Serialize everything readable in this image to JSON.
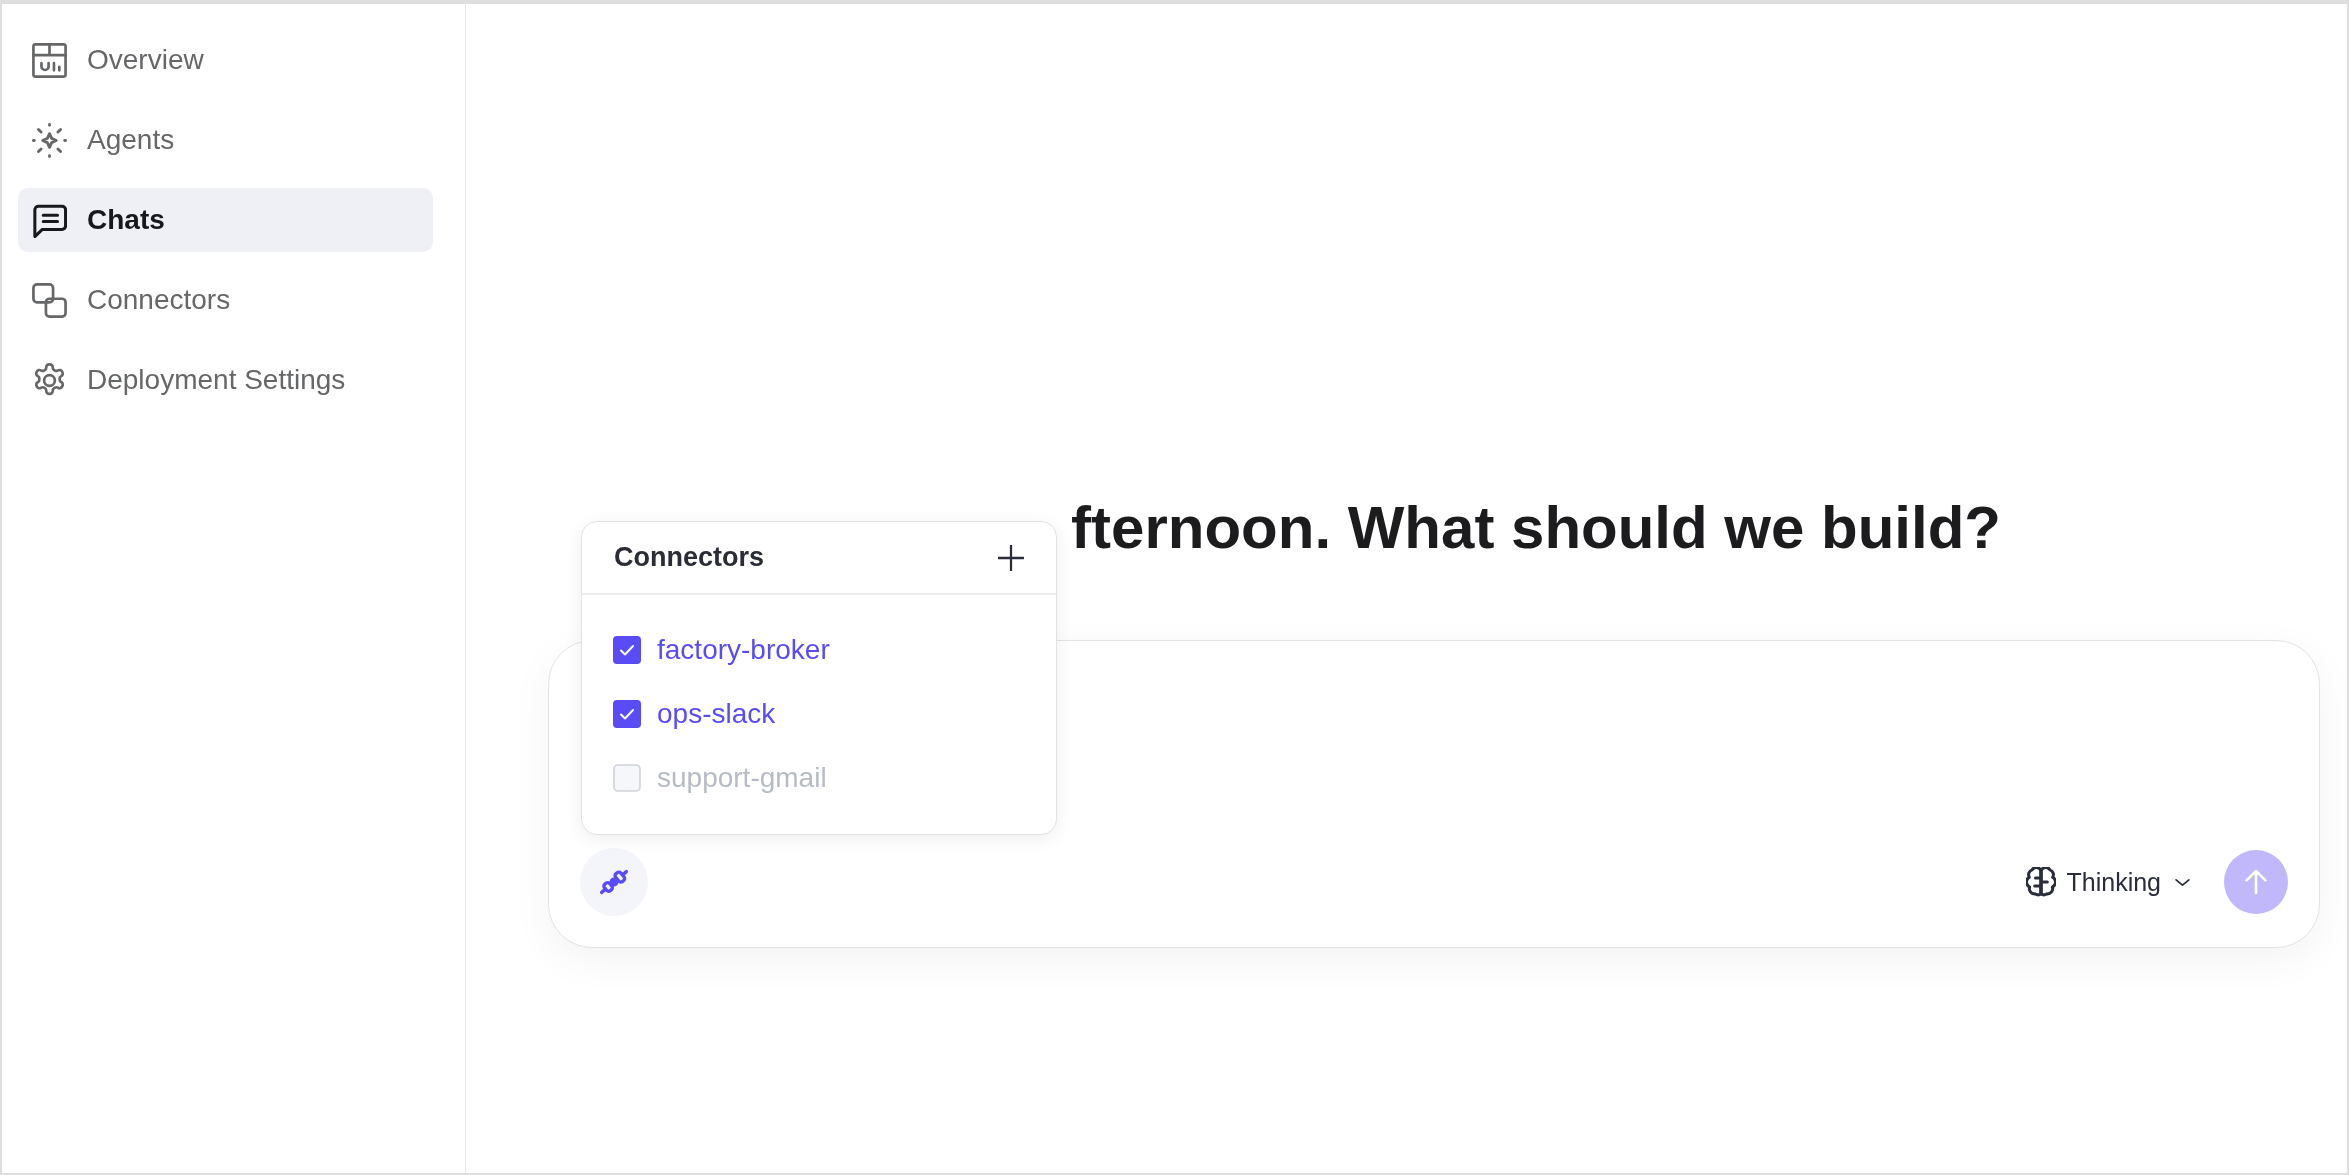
{
  "sidebar": {
    "items": [
      {
        "label": "Overview",
        "selected": false
      },
      {
        "label": "Agents",
        "selected": false
      },
      {
        "label": "Chats",
        "selected": true
      },
      {
        "label": "Connectors",
        "selected": false
      },
      {
        "label": "Deployment Settings",
        "selected": false
      }
    ]
  },
  "main": {
    "heading": "fternoon. What should we build?"
  },
  "composer": {
    "connectors_popover": {
      "title": "Connectors",
      "items": [
        {
          "label": "factory-broker",
          "checked": true
        },
        {
          "label": "ops-slack",
          "checked": true
        },
        {
          "label": "support-gmail",
          "checked": false
        }
      ]
    },
    "model_selector": {
      "label": "Thinking"
    },
    "send_button": {
      "disabled": true
    }
  }
}
